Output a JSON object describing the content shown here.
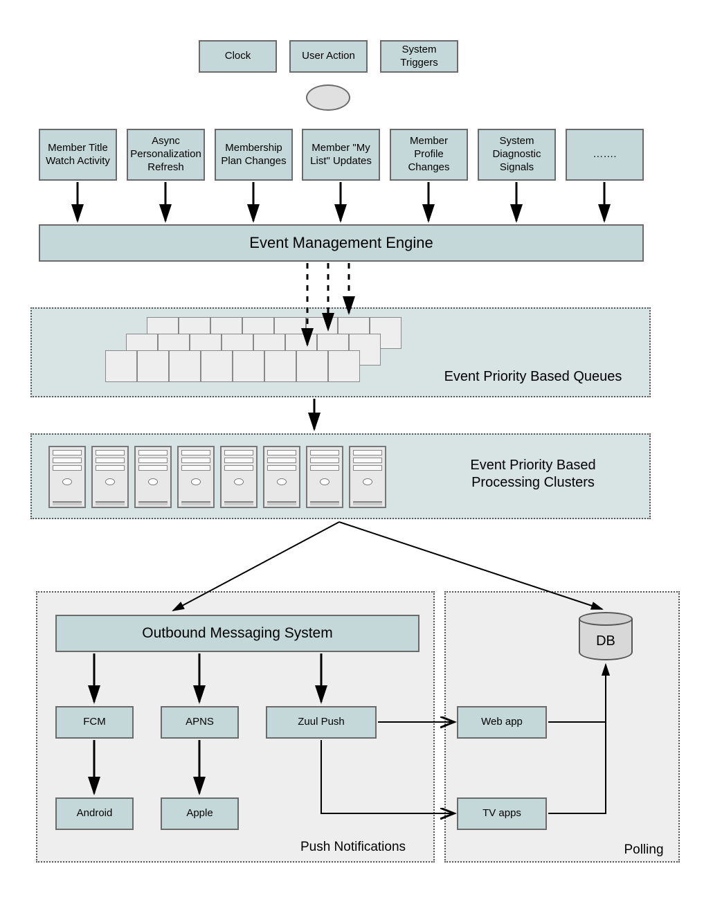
{
  "triggers": {
    "clock": "Clock",
    "user_action": "User Action",
    "system_triggers": "System\nTriggers"
  },
  "events": [
    "Member Title Watch Activity",
    "Async Personalization Refresh",
    "Membership Plan Changes",
    "Member \"My List\" Updates",
    "Member Profile Changes",
    "System Diagnostic Signals",
    "……."
  ],
  "engine_label": "Event Management Engine",
  "queues_label": "Event Priority Based Queues",
  "clusters_label": "Event Priority Based\nProcessing Clusters",
  "outbound_label": "Outbound Messaging System",
  "channels": {
    "fcm": "FCM",
    "apns": "APNS",
    "zuul": "Zuul Push",
    "android": "Android",
    "apple": "Apple",
    "webapp": "Web app",
    "tvapps": "TV apps"
  },
  "regions": {
    "push": "Push Notifications",
    "polling": "Polling"
  },
  "db_label": "DB"
}
